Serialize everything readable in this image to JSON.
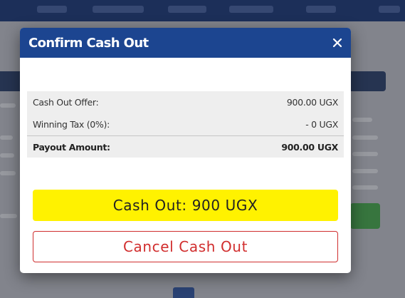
{
  "modal": {
    "title": "Confirm Cash Out",
    "close_icon": "close-icon",
    "rows": [
      {
        "label": "Cash Out Offer:",
        "value": "900.00 UGX"
      },
      {
        "label": "Winning Tax (0%):",
        "value": "- 0 UGX"
      },
      {
        "label": "Payout Amount:",
        "value": "900.00 UGX"
      }
    ],
    "cash_out_button": "Cash Out: 900 UGX",
    "cancel_button": "Cancel Cash Out"
  },
  "colors": {
    "header": "#1c4590",
    "cash_out_button": "#fff200",
    "cancel_border": "#cf2e2e",
    "summary_background": "#eeeeee"
  }
}
